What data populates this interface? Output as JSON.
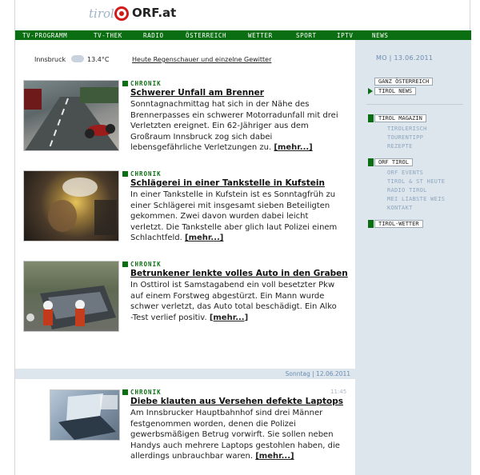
{
  "header": {
    "region": "tirol",
    "brand": "ORF.at"
  },
  "nav": {
    "items": [
      "TV-PROGRAMM",
      "TV-THEK",
      "RADIO",
      "ÖSTERREICH",
      "WETTER",
      "SPORT",
      "IPTV",
      "NEWS"
    ]
  },
  "weather": {
    "city": "Innsbruck",
    "icon": "cloud-rain-icon",
    "temp": "13.4°C",
    "forecast": "Heute Regenschauer und einzelne Gewitter"
  },
  "sidebar": {
    "date": "MO | 13.06.2011",
    "buttons": [
      "GANZ ÖSTERREICH",
      "TIROL NEWS"
    ],
    "magazin": {
      "label": "TIROL MAGAZIN",
      "links": [
        "TIROLERISCH",
        "TOURENTIPP",
        "REZEPTE"
      ]
    },
    "orf_tirol": {
      "label": "ORF TIROL",
      "links": [
        "ORF EVENTS",
        "TIROL & ST HEUTE",
        "RADIO TIROL",
        "MEI LIABSTE WEIS",
        "KONTAKT"
      ]
    },
    "wetter": "TIROL-WETTER"
  },
  "articles": [
    {
      "category": "CHRONIK",
      "headline": "Schwerer Unfall am Brenner",
      "lines": [
        "Sonntagnachmittag hat sich in der Nähe des",
        "Brennerpasses ein schwerer Motorradunfall mit drei",
        "Verletzten ereignet. Ein 62-Jähriger aus dem",
        "Großraum Innsbruck zog sich dabei",
        "lebensgefährliche Verletzungen zu."
      ],
      "more": "[mehr...]"
    },
    {
      "category": "CHRONIK",
      "headline": "Schlägerei in einer Tankstelle in Kufstein",
      "lines": [
        "In einer Tankstelle in Kufstein ist es Sonntagfrüh zu",
        "einer Schlägerei mit insgesamt sieben Beteiligten",
        "gekommen. Zwei davon wurden dabei leicht",
        "verletzt. Die Tankstelle aber glich laut Polizei einem",
        "Schlachtfeld."
      ],
      "more": "[mehr...]"
    },
    {
      "category": "CHRONIK",
      "headline": "Betrunkener lenkte volles Auto in den Graben",
      "lines": [
        "In Osttirol ist Samstagabend ein voll besetzter Pkw",
        "auf einem Forstweg abgestürzt. Ein Mann wurde",
        "schwer verletzt, das Auto total beschädigt. Ein Alko",
        "-Test verlief positiv."
      ],
      "more": "[mehr...]"
    },
    {
      "category": "CHRONIK",
      "time": "11:45",
      "headline": "Diebe klauten aus Versehen defekte Laptops",
      "lines": [
        "Am Innsbrucker Hauptbahnhof sind drei Männer",
        "festgenommen worden, denen die Polizei",
        "gewerbsmäßigen Betrug vorwirft. Sie sollen neben",
        "Handys auch mehrere Laptops gestohlen haben, die",
        "allerdings unbrauchbar waren."
      ],
      "more": "[mehr...]"
    }
  ],
  "daybar": "Sonntag | 12.06.2011"
}
